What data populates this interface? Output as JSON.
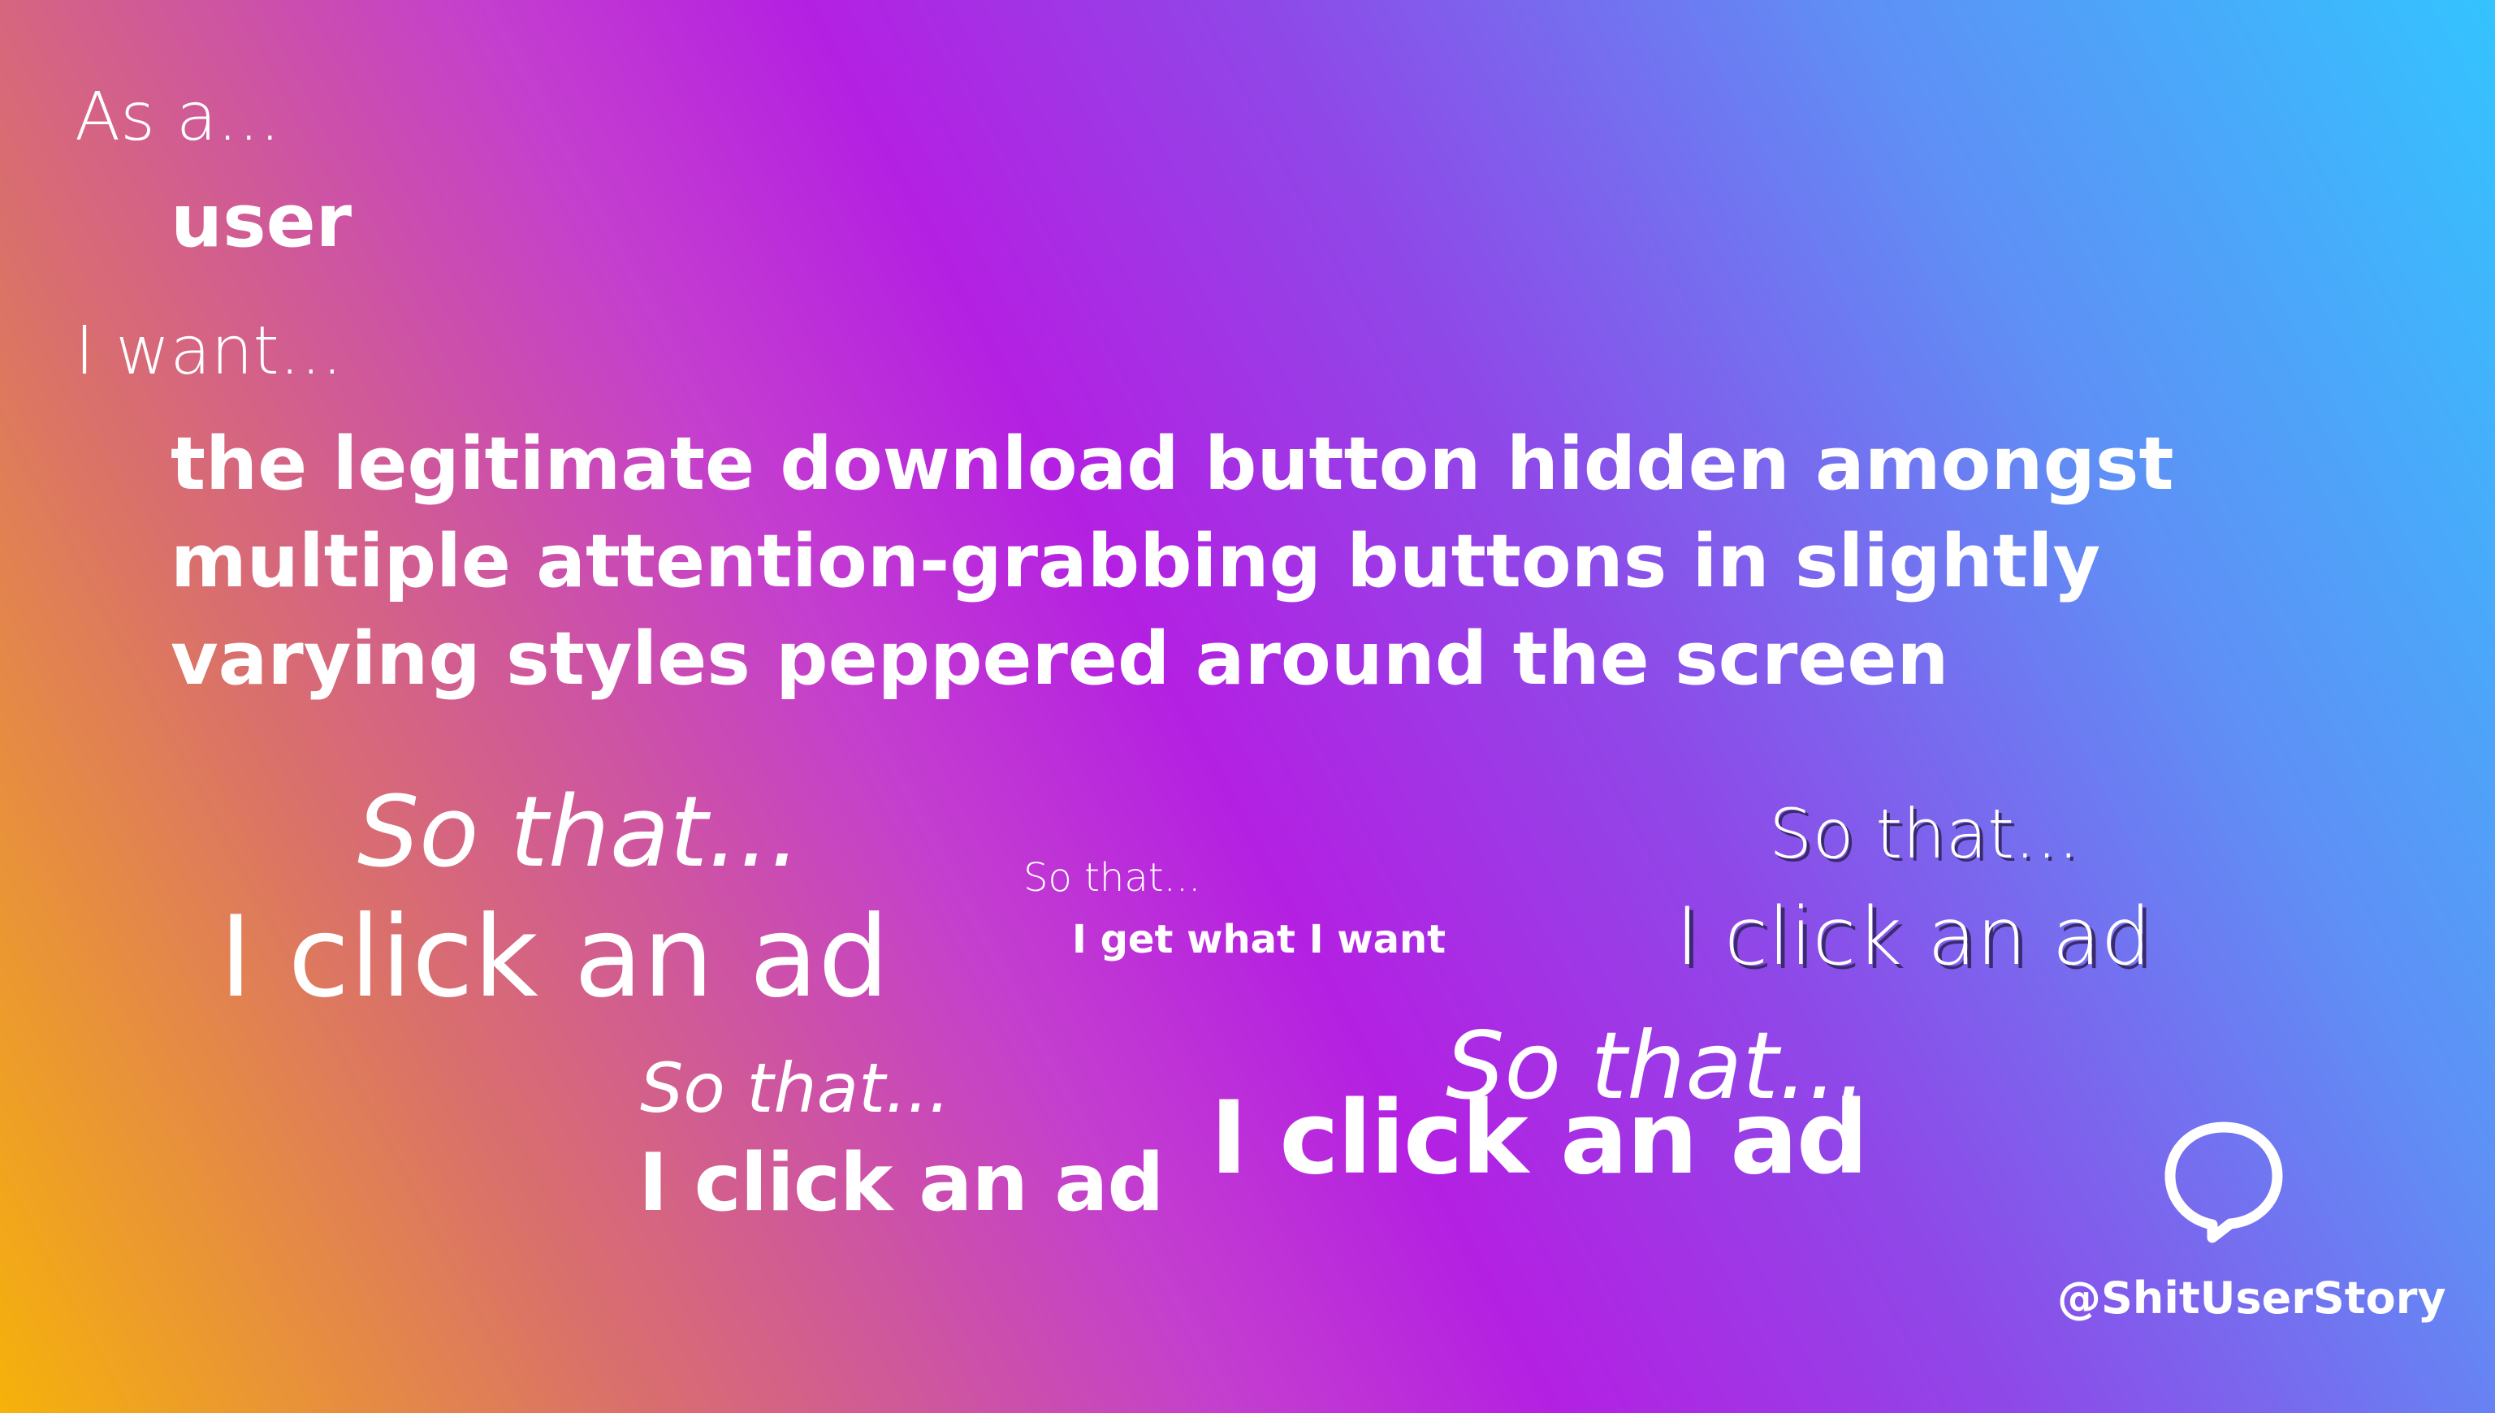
{
  "story": {
    "as_a_label": "As a...",
    "role": "user",
    "i_want_label": "I want...",
    "want": "the legitimate download button hidden amongst multiple attention-grabbing buttons in slightly varying styles peppered around the screen"
  },
  "so_that_blocks": [
    {
      "label": "So that...",
      "result": "I click an ad"
    },
    {
      "label": "So that...",
      "result": "I get what I want"
    },
    {
      "label": "So that...",
      "result": "I click an ad"
    },
    {
      "label": "So that...",
      "result": "I click an ad"
    },
    {
      "label": "So that...",
      "result": "I click an ad"
    }
  ],
  "branding": {
    "icon": "speech-bubble-icon",
    "handle": "@ShitUserStory"
  },
  "colors": {
    "gradient_start": "#f6b20a",
    "gradient_mid": "#b420e2",
    "gradient_end": "#33c4ff",
    "text": "#ffffff"
  }
}
